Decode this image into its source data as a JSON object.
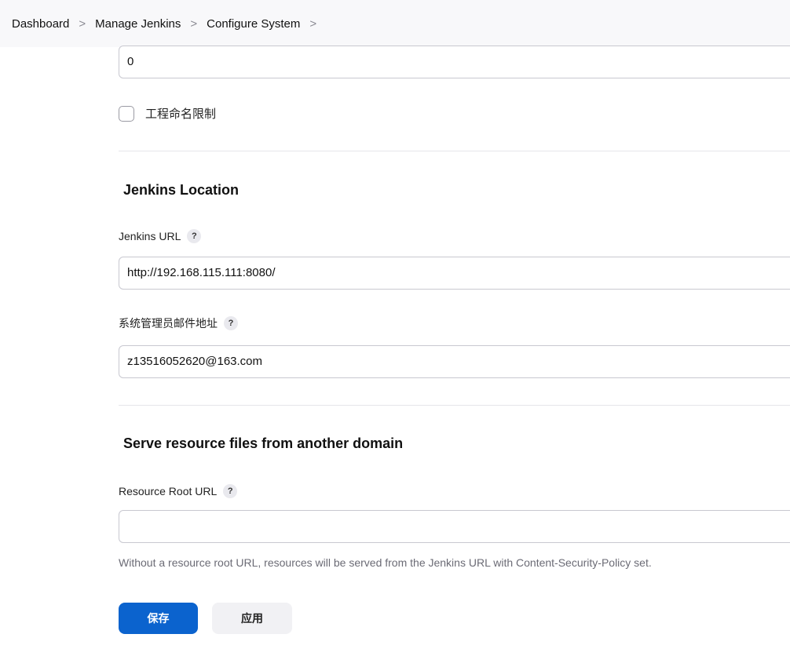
{
  "breadcrumb": {
    "items": [
      "Dashboard",
      "Manage Jenkins",
      "Configure System"
    ],
    "separator": ">"
  },
  "top_field": {
    "value": "0"
  },
  "project_naming": {
    "label": "工程命名限制",
    "checked": false
  },
  "jenkins_location": {
    "title": "Jenkins Location",
    "url_label": "Jenkins URL",
    "url_value": "http://192.168.115.111:8080/",
    "email_label": "系统管理员邮件地址",
    "email_value": "z13516052620@163.com"
  },
  "resource_domain": {
    "title": "Serve resource files from another domain",
    "root_label": "Resource Root URL",
    "root_value": "",
    "helper": "Without a resource root URL, resources will be served from the Jenkins URL with Content-Security-Policy set."
  },
  "help_icon_text": "?",
  "footer": {
    "save_label": "保存",
    "apply_label": "应用"
  },
  "colors": {
    "primary": "#0b63ce",
    "secondary_button": "#f1f1f4",
    "helper_text": "#6b6b75"
  }
}
